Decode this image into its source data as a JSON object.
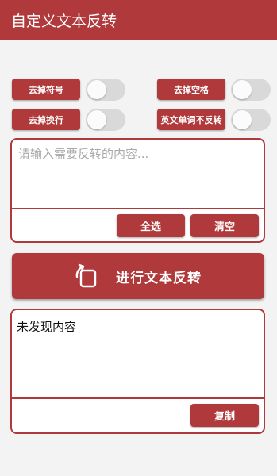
{
  "app": {
    "title": "自定义文本反转"
  },
  "options": {
    "remove_punct": {
      "label": "去掉符号",
      "enabled": false
    },
    "remove_space": {
      "label": "去掉空格",
      "enabled": false
    },
    "remove_newline": {
      "label": "去掉换行",
      "enabled": false
    },
    "english_words_keep": {
      "label": "英文单词不反转",
      "enabled": false
    }
  },
  "input": {
    "placeholder": "请输入需要反转的内容...",
    "value": ""
  },
  "input_actions": {
    "select_all": "全选",
    "clear": "清空"
  },
  "action": {
    "label": "进行文本反转",
    "icon": "rotate-icon"
  },
  "output": {
    "text": "未发现内容",
    "copy": "复制"
  },
  "colors": {
    "accent": "#b0393b",
    "background": "#f3f3f3",
    "toggle_off": "#d9d9d9"
  }
}
